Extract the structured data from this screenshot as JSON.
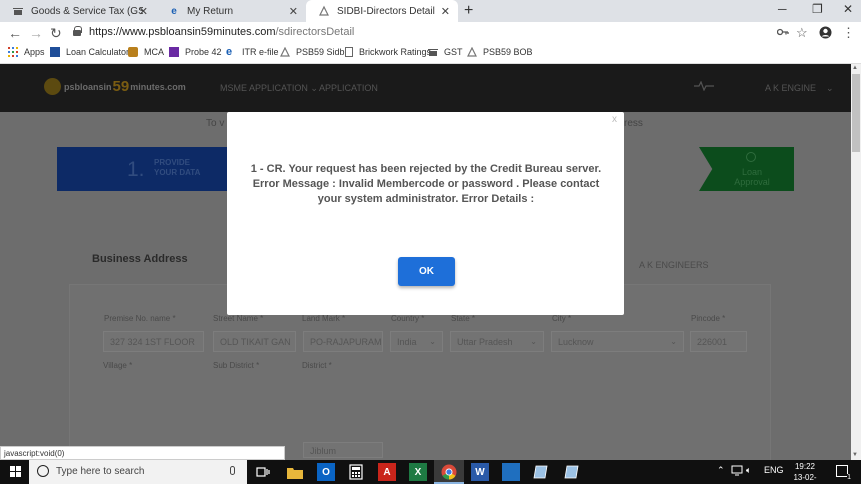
{
  "browser": {
    "tabs": [
      {
        "title": "Goods & Service Tax (GST) | Servi",
        "icon": "gst-icon",
        "active": false
      },
      {
        "title": "My Return",
        "icon": "ie-e-icon",
        "active": false
      },
      {
        "title": "SIDBI-Directors Detail",
        "icon": "site-icon",
        "active": true
      }
    ],
    "new_tab": "+",
    "window_controls": {
      "minimize": "─",
      "maximize": "❐",
      "close": "✕"
    },
    "url_host": "https://www.psbloansin59minutes.com",
    "url_path": "/sdirectorsDetail",
    "bookmarks": [
      "Apps",
      "Loan Calculator",
      "MCA",
      "Probe 42",
      "ITR e-file",
      "PSB59 Sidbi",
      "Brickwork Ratings",
      "GST",
      "PSB59 BOB"
    ],
    "status_url": "javascript:void(0)"
  },
  "site": {
    "logo_prefix": "psbloansin",
    "logo_59": "59",
    "logo_suffix": "minutes.com",
    "nav": [
      "MSME APPLICATION",
      "APPLICATION"
    ],
    "user": "A K ENGINE",
    "bg_left": "To v",
    "bg_right": "ress",
    "step1_num": "1.",
    "step1_label_line1": "PROVIDE",
    "step1_label_line2": "YOUR DATA",
    "step_last_line1": "Loan",
    "step_last_line2": "Approval",
    "card_title": "Business Address",
    "card_org": "A K ENGINEERS",
    "fields": [
      {
        "label": "Premise No. name *",
        "value": "327 324 1ST FLOOR",
        "select": false
      },
      {
        "label": "Street Name *",
        "value": "OLD TIKAIT GAN",
        "select": false
      },
      {
        "label": "Land Mark *",
        "value": "PO-RAJAPURAM",
        "select": false
      },
      {
        "label": "Country *",
        "value": "India",
        "select": true
      },
      {
        "label": "State *",
        "value": "Uttar Pradesh",
        "select": true
      },
      {
        "label": "City *",
        "value": "Lucknow",
        "select": true
      },
      {
        "label": "Pincode *",
        "value": "226001",
        "select": false
      }
    ],
    "fields_row2": [
      "Village *",
      "Sub District *",
      "District *"
    ],
    "district_value": "Jiblum"
  },
  "modal": {
    "close": "x",
    "message": "1 - CR. Your request has been rejected by the Credit Bureau server. Error Message : Invalid Membercode or password . Please contact your system administrator. Error Details :",
    "ok_label": "OK"
  },
  "taskbar": {
    "search_placeholder": "Type here to search",
    "lang": "ENG",
    "time": "19:22",
    "date": "13-02-2019",
    "notification_count": "1"
  }
}
